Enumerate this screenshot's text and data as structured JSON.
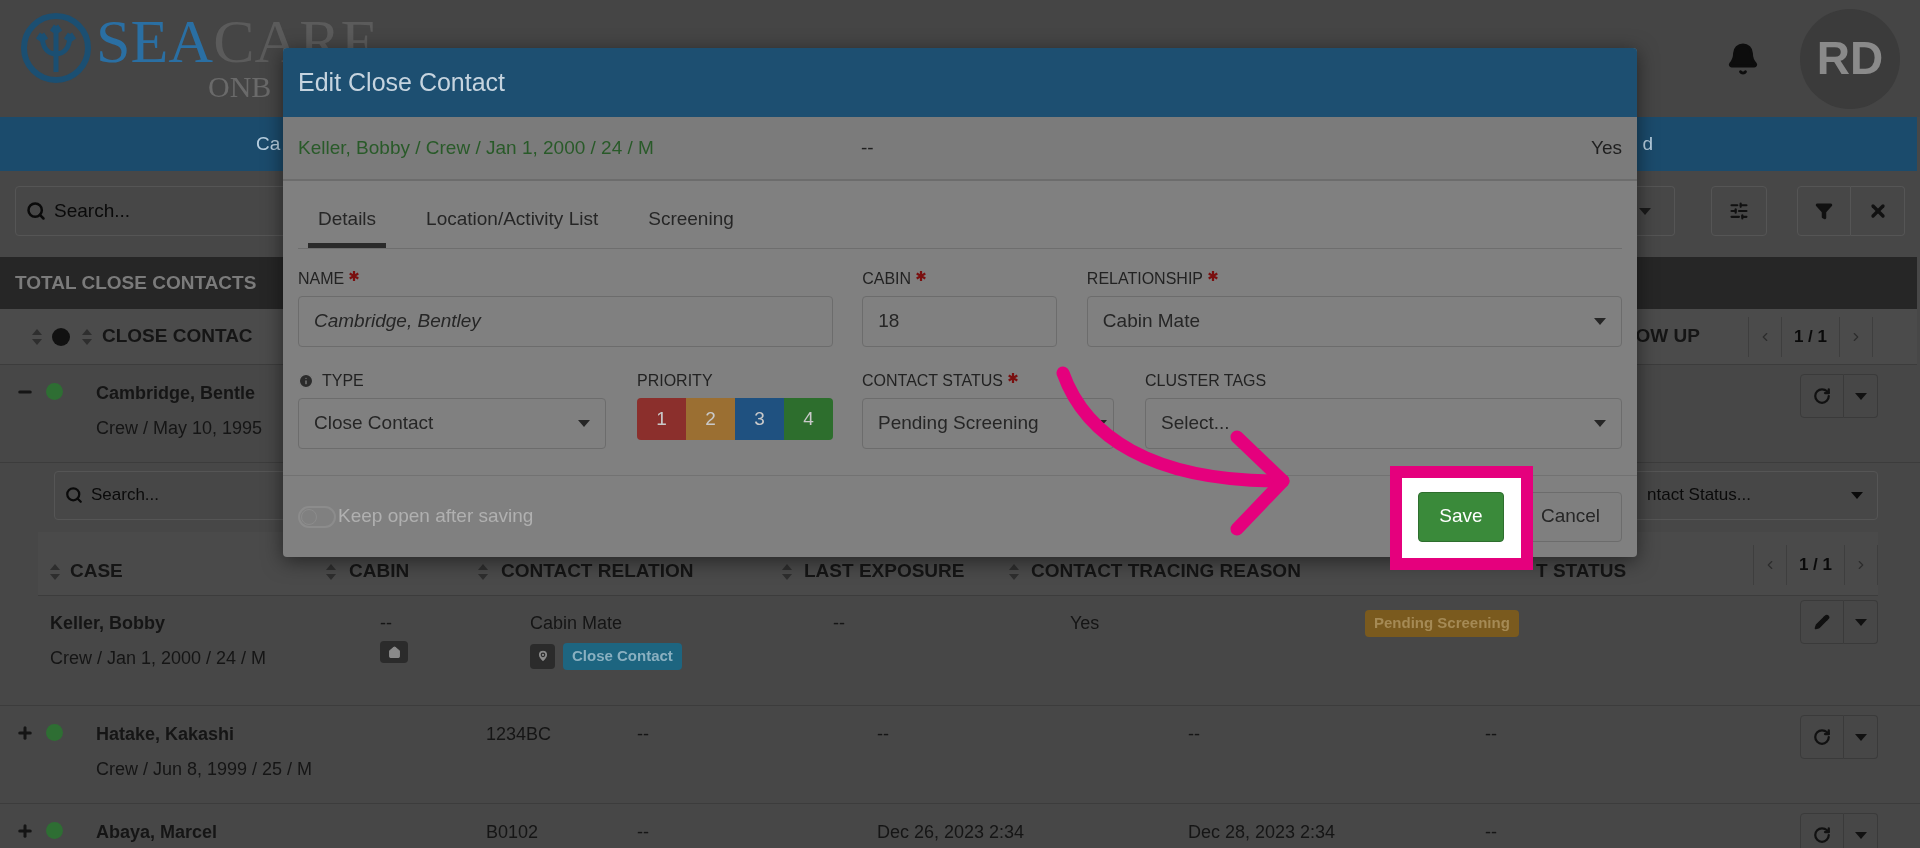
{
  "header": {
    "logo": {
      "primary": "SEA",
      "secondary": "CARE",
      "tagline": "ONB"
    },
    "avatar_initials": "RD"
  },
  "nav": {
    "items": [
      {
        "label": "Ca"
      },
      {
        "label": "d"
      }
    ]
  },
  "toolbar": {
    "search": {
      "placeholder": "Search..."
    }
  },
  "summary_bar": {
    "label": "TOTAL CLOSE CONTACTS"
  },
  "table": {
    "columns": [
      {
        "label": "CLOSE CONTAC"
      },
      {
        "label": "OW UP"
      }
    ],
    "pager": "1 / 1",
    "rows": [
      {
        "name": "Cambridge, Bentle",
        "details": "Crew / May 10, 1995",
        "expanded": true
      },
      {
        "name": "Hatake, Kakashi",
        "details": "Crew / Jun 8, 1999 / 25 / M",
        "expanded": false,
        "cells": [
          "1234BC",
          "--",
          "--",
          "--",
          "--"
        ]
      },
      {
        "name": "Abaya, Marcel",
        "expanded": false,
        "cells": [
          "B0102",
          "--",
          "Dec 26, 2023 2:34",
          "Dec 28, 2023 2:34",
          "--"
        ]
      }
    ]
  },
  "subpanel": {
    "search": {
      "placeholder": "Search..."
    },
    "status_filter": {
      "placeholder": "ntact Status..."
    },
    "columns": [
      {
        "label": "CASE"
      },
      {
        "label": "CABIN"
      },
      {
        "label": "CONTACT RELATION"
      },
      {
        "label": "LAST EXPOSURE"
      },
      {
        "label": "CONTACT TRACING REASON"
      },
      {
        "label": "T STATUS"
      }
    ],
    "pager": "1 / 1",
    "rows": [
      {
        "name": "Keller, Bobby",
        "details": "Crew / Jan 1, 2000 / 24 / M",
        "cabin": "--",
        "relation": "Cabin Mate",
        "tag": "Close Contact",
        "last_exposure": "--",
        "reason": "Yes",
        "status": "Pending Screening"
      }
    ]
  },
  "modal": {
    "title": "Edit Close Contact",
    "summary": {
      "person": "Keller, Bobby / Crew / Jan 1, 2000 / 24 / M",
      "cabin": "--",
      "reason": "Yes"
    },
    "tabs": [
      {
        "label": "Details",
        "selected": true
      },
      {
        "label": "Location/Activity List",
        "selected": false
      },
      {
        "label": "Screening",
        "selected": false
      }
    ],
    "fields": {
      "name": {
        "label": "NAME",
        "required": true,
        "value": "Cambridge, Bentley"
      },
      "cabin": {
        "label": "CABIN",
        "required": true,
        "value": "18"
      },
      "relationship": {
        "label": "RELATIONSHIP",
        "required": true,
        "value": "Cabin Mate"
      },
      "type": {
        "label": "TYPE",
        "required": false,
        "value": "Close Contact"
      },
      "priority": {
        "label": "PRIORITY",
        "options": [
          {
            "label": "1",
            "color": "#8b2f2c"
          },
          {
            "label": "2",
            "color": "#9b6f32"
          },
          {
            "label": "3",
            "color": "#1f5180"
          },
          {
            "label": "4",
            "color": "#2d6e2d"
          }
        ]
      },
      "contact_status": {
        "label": "CONTACT STATUS",
        "required": true,
        "value": "Pending Screening"
      },
      "cluster_tags": {
        "label": "CLUSTER TAGS",
        "required": false,
        "placeholder": "Select..."
      }
    },
    "keep_open": {
      "label": "Keep open after saving",
      "on": false
    },
    "buttons": {
      "save": "Save",
      "cancel": "Cancel"
    }
  }
}
